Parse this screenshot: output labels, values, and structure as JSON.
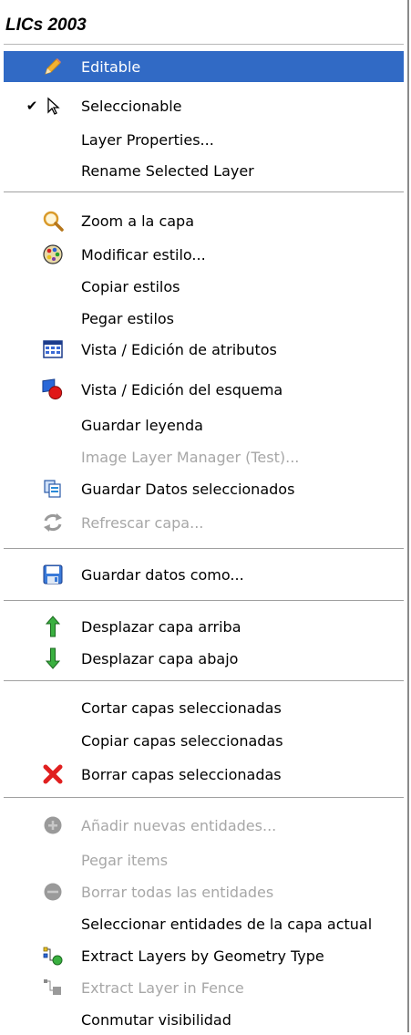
{
  "title": "LICs 2003",
  "items": {
    "editable": "Editable",
    "seleccionable": "Seleccionable",
    "layer_properties": "Layer Properties...",
    "rename_layer": "Rename Selected Layer",
    "zoom_capa": "Zoom a la capa",
    "modificar_estilo": "Modificar estilo...",
    "copiar_estilos": "Copiar estilos",
    "pegar_estilos": "Pegar estilos",
    "vista_atributos": "Vista / Edición de atributos",
    "vista_esquema": "Vista / Edición del esquema",
    "guardar_leyenda": "Guardar leyenda",
    "image_layer_manager": "Image Layer Manager (Test)...",
    "guardar_datos_sel": "Guardar Datos seleccionados",
    "refrescar_capa": "Refrescar capa...",
    "guardar_datos_como": "Guardar datos como...",
    "desplazar_arriba": "Desplazar capa arriba",
    "desplazar_abajo": "Desplazar capa abajo",
    "cortar_capas": "Cortar capas seleccionadas",
    "copiar_capas": "Copiar capas seleccionadas",
    "borrar_capas": "Borrar capas seleccionadas",
    "anadir_entidades": "Añadir nuevas entidades...",
    "pegar_items": "Pegar items",
    "borrar_entidades": "Borrar todas las entidades",
    "seleccionar_entidades": "Seleccionar entidades de la capa actual",
    "extract_by_geometry": "Extract Layers by Geometry Type",
    "extract_in_fence": "Extract Layer in Fence",
    "conmutar_visibilidad": "Conmutar visibilidad"
  },
  "state": {
    "highlighted_item": "Editable",
    "checked_item": "Seleccionable",
    "disabled_items": [
      "Image Layer Manager (Test)...",
      "Refrescar capa...",
      "Añadir nuevas entidades...",
      "Pegar items",
      "Borrar todas las entidades",
      "Extract Layer in Fence"
    ]
  },
  "icons": {
    "editable": "pencil-icon",
    "seleccionable": "pointer-cursor-icon",
    "zoom_capa": "magnifier-icon",
    "modificar_estilo": "palette-icon",
    "vista_atributos": "table-grid-icon",
    "vista_esquema": "schema-icon",
    "guardar_datos_sel": "copy-documents-icon",
    "refrescar_capa": "refresh-icon",
    "guardar_datos_como": "floppy-disk-icon",
    "desplazar_arriba": "arrow-up-icon",
    "desplazar_abajo": "arrow-down-icon",
    "borrar_capas": "red-x-icon",
    "anadir_entidades": "plus-circle-icon",
    "borrar_entidades": "minus-circle-icon",
    "extract_by_geometry": "extract-geometry-icon",
    "extract_in_fence": "extract-fence-icon"
  },
  "colors": {
    "highlight": "#316ac5",
    "disabled_text": "#a7a7a7",
    "separator": "#a0a0a0"
  }
}
